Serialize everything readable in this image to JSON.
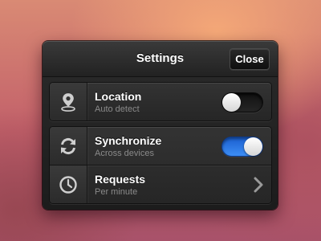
{
  "header": {
    "title": "Settings",
    "close_label": "Close"
  },
  "rows": [
    {
      "label": "Location",
      "sublabel": "Auto detect",
      "icon": "location-pin-icon",
      "control": "toggle",
      "state": "off"
    },
    {
      "label": "Synchronize",
      "sublabel": "Across devices",
      "icon": "sync-icon",
      "control": "toggle",
      "state": "on"
    },
    {
      "label": "Requests",
      "sublabel": "Per minute",
      "icon": "clock-icon",
      "control": "chevron"
    }
  ],
  "colors": {
    "toggle_on": "#2f7fe8",
    "panel": "#222222",
    "accent_text": "#ffffff",
    "sub_text": "#8a8a8a"
  }
}
